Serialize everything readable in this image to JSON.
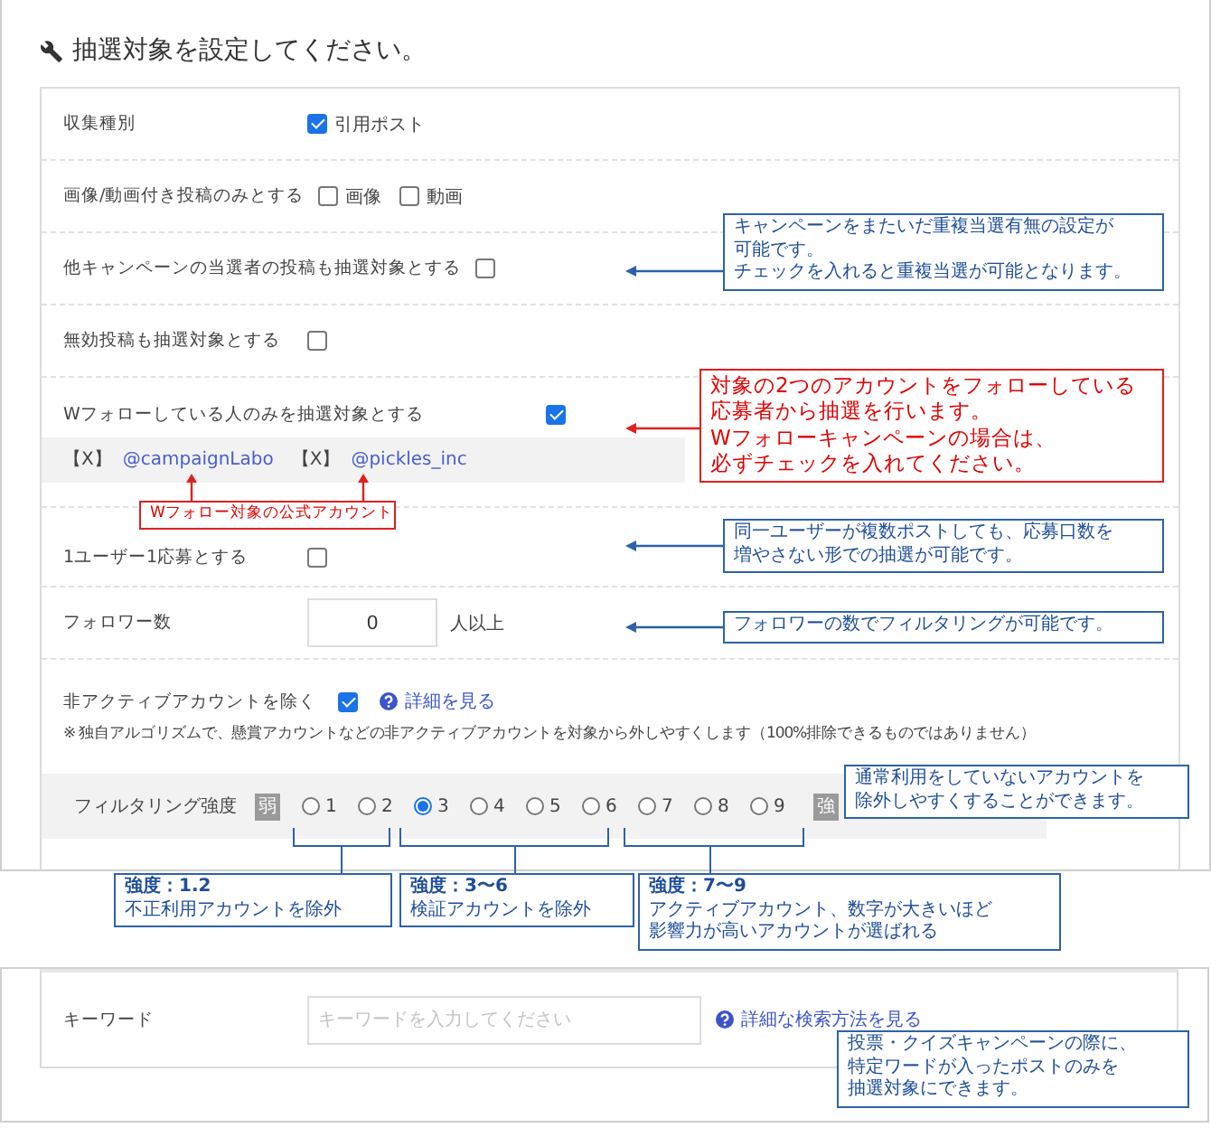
{
  "title": "抽選対象を設定してください。",
  "rows": [
    {
      "kind": "checks",
      "label": "収集種別",
      "options": [
        {
          "label": "引用ポスト",
          "checked": true
        }
      ]
    },
    {
      "kind": "checks",
      "label": "画像/動画付き投稿のみとする",
      "options": [
        {
          "label": "画像",
          "checked": false
        },
        {
          "label": "動画",
          "checked": false
        }
      ]
    },
    {
      "kind": "checks",
      "label": "他キャンペーンの当選者の投稿も抽選対象とする",
      "options": [
        {
          "checked": false
        }
      ]
    },
    {
      "kind": "checks",
      "label": "無効投稿も抽選対象とする",
      "options": [
        {
          "checked": false
        }
      ]
    },
    {
      "kind": "follow",
      "label": "Wフォローしている人のみを抽選対象とする",
      "checked": true,
      "accounts": [
        {
          "tag": "【X】",
          "handle": "@campaignLabo"
        },
        {
          "tag": "【X】",
          "handle": "@pickles_inc"
        }
      ]
    },
    {
      "kind": "checks",
      "label": "1ユーザー1応募とする",
      "options": [
        {
          "checked": false
        }
      ]
    },
    {
      "kind": "number",
      "label": "フォロワー数",
      "value": "0",
      "unit": "人以上"
    },
    {
      "kind": "inactive",
      "label": "非アクティブアカウントを除く",
      "checked": true,
      "help_link": "詳細を見る",
      "note": "※ 独自アルゴリズムで、懸賞アカウントなどの非アクティブアカウントを対象から外しやすくします（100%排除できるものではありません）",
      "filter": {
        "label": "フィルタリング強度",
        "low": "弱",
        "high": "強",
        "options": [
          {
            "label": "1",
            "selected": false
          },
          {
            "label": "2",
            "selected": false
          },
          {
            "label": "3",
            "selected": true
          },
          {
            "label": "4",
            "selected": false
          },
          {
            "label": "5",
            "selected": false
          },
          {
            "label": "6",
            "selected": false
          },
          {
            "label": "7",
            "selected": false
          },
          {
            "label": "8",
            "selected": false
          },
          {
            "label": "9",
            "selected": false
          }
        ]
      }
    }
  ],
  "keyword": {
    "label": "キーワード",
    "placeholder": "キーワードを入力してください",
    "help_link": "詳細な検索方法を見る"
  },
  "annotations": [
    {
      "kind": "blue",
      "lines": [
        "キャンペーンをまたいだ重複当選有無の設定が",
        "可能です。",
        "チェックを入れると重複当選が可能となります。"
      ]
    },
    {
      "kind": "red",
      "lines": [
        "対象の2つのアカウントをフォローしている",
        "応募者から抽選を行います。",
        "Wフォローキャンペーンの場合は、",
        "必ずチェックを入れてください。"
      ]
    },
    {
      "kind": "red-label",
      "lines": [
        "Wフォロー対象の公式アカウント"
      ]
    },
    {
      "kind": "blue",
      "lines": [
        "同一ユーザーが複数ポストしても、応募口数を",
        "増やさない形での抽選が可能です。"
      ]
    },
    {
      "kind": "blue",
      "lines": [
        "フォロワーの数でフィルタリングが可能です。"
      ]
    },
    {
      "kind": "blue",
      "lines": [
        "通常利用をしていないアカウントを",
        "除外しやすくすることができます。"
      ]
    },
    {
      "kind": "blue",
      "heading": "強度：1.2",
      "lines": [
        "不正利用アカウントを除外"
      ]
    },
    {
      "kind": "blue",
      "heading": "強度：3〜6",
      "lines": [
        "検証アカウントを除外"
      ]
    },
    {
      "kind": "blue",
      "heading": "強度：7〜9",
      "lines": [
        "アクティブアカウント、数字が大きいほど",
        "影響力が高いアカウントが選ばれる"
      ]
    },
    {
      "kind": "blue",
      "lines": [
        "投票・クイズキャンペーンの際に、",
        "特定ワードが入ったポストのみを",
        "抽選対象にできます。"
      ]
    }
  ]
}
